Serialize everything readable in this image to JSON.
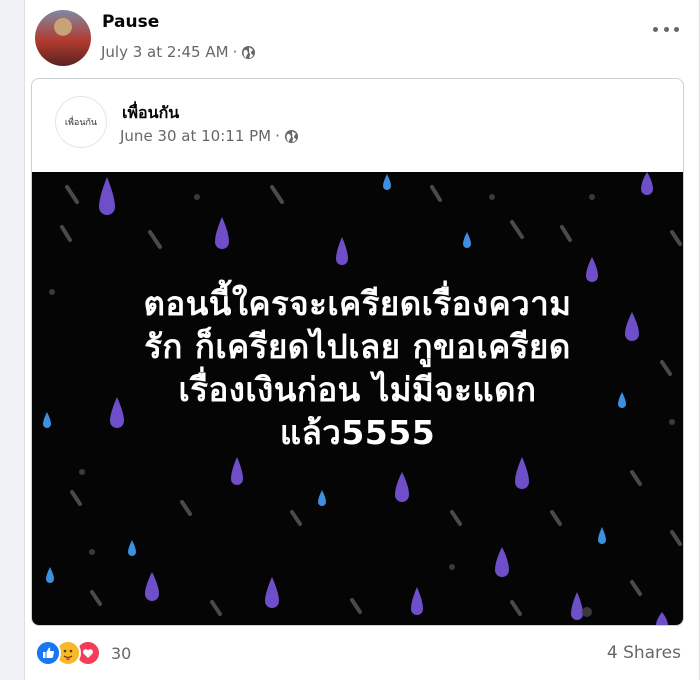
{
  "post": {
    "author": "Pause",
    "timestamp": "July 3 at 2:45 AM",
    "separator": "·",
    "audience_icon": "globe-icon",
    "menu_icon": "more-options-icon"
  },
  "shared_post": {
    "page_logo_text": "เพื่อนกัน",
    "page_name": "เพื่อนกัน",
    "timestamp": "June 30 at 10:11 PM",
    "separator": "·",
    "audience_icon": "globe-icon",
    "image_text_lines": [
      "ตอนนี้ใครจะเครียดเรื่องความ",
      "รัก ก็เครียดไปเลย กูขอเครียด",
      "เรื่องเงินก่อน ไม่มีจะแดก",
      "แล้ว5555"
    ]
  },
  "footer": {
    "reaction_icons": [
      "like-icon",
      "care-icon",
      "love-icon"
    ],
    "reaction_count": "30",
    "shares": "4 Shares"
  },
  "colors": {
    "background": "#f0f2f5",
    "meta_text": "#65676b",
    "like": "#1877f2",
    "care": "#f7b928",
    "love": "#f33e58",
    "rain_purple": "#6f4fc9",
    "rain_blue": "#3d8fe0",
    "rain_gray": "#4a4a4a"
  }
}
